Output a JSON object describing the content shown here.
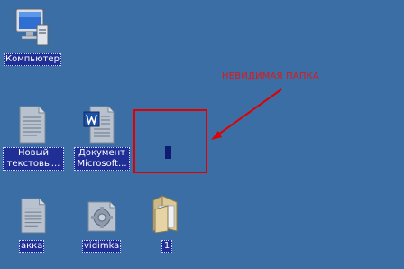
{
  "desktop": {
    "background_color": "#3a6ea5",
    "icons": {
      "computer": {
        "label": "Компьютер",
        "icon": "computer-icon"
      },
      "new_text_doc": {
        "label_line1": "Новый",
        "label_line2": "текстовы...",
        "icon": "text-document-icon"
      },
      "ms_doc": {
        "label_line1": "Документ",
        "label_line2": "Microsoft...",
        "icon": "word-document-icon"
      },
      "akka": {
        "label": "акка",
        "icon": "text-document-icon"
      },
      "vidimka": {
        "label": "vidimka",
        "icon": "settings-file-icon"
      },
      "folder_1": {
        "label": "1",
        "icon": "folder-icon"
      }
    }
  },
  "annotation": {
    "text": "НЕВИДИМАЯ ПАПКА",
    "color": "#e01818"
  }
}
